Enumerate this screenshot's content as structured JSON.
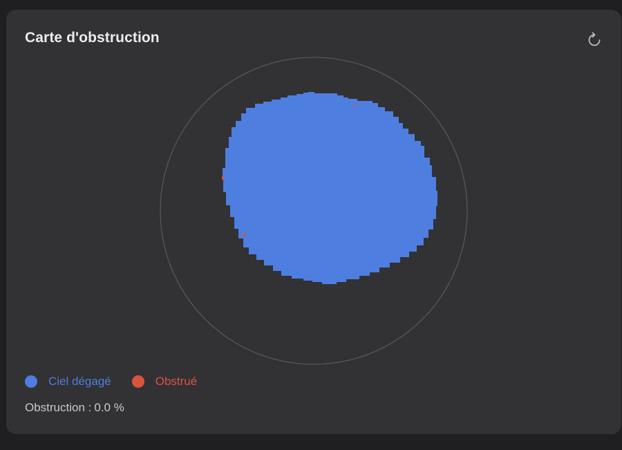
{
  "panel": {
    "title": "Carte d'obstruction",
    "refresh_icon": "refresh-icon"
  },
  "legend": {
    "clear": {
      "label": "Ciel dégagé",
      "color": "#4e7ee0"
    },
    "obstructed": {
      "label": "Obstrué",
      "color": "#d9543f"
    }
  },
  "stats": {
    "label": "Obstruction :",
    "value": "0.0 %"
  },
  "colors": {
    "background": "#1f1f21",
    "panel": "#323133",
    "horizon_ring": "#585858",
    "clear": "#4e7ee0",
    "obstructed": "#d9543f"
  }
}
